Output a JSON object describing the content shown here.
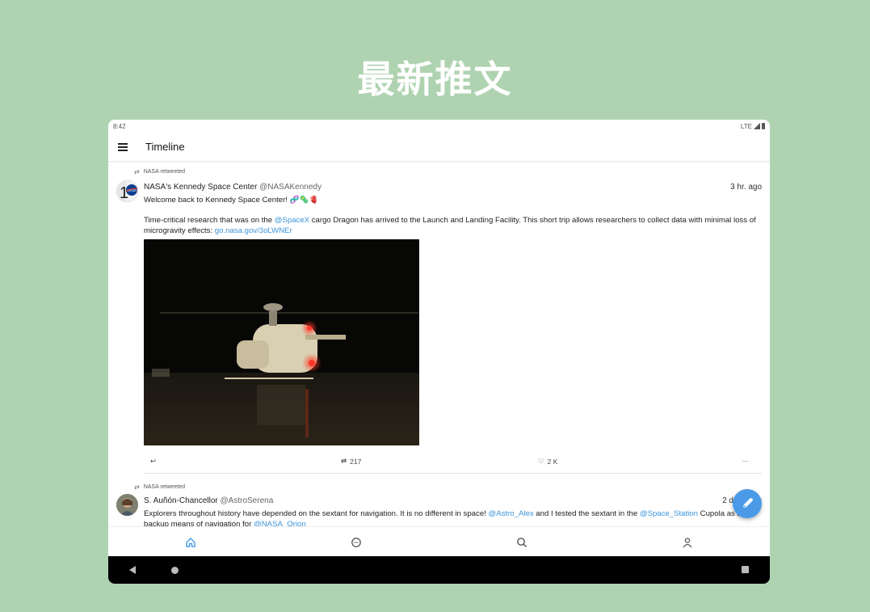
{
  "banner": {
    "title": "最新推文"
  },
  "status_bar": {
    "time": "8:42",
    "network": "LTE"
  },
  "app_bar": {
    "title": "Timeline"
  },
  "tweets": [
    {
      "retweeted_by": "NASA retweeted",
      "author": "NASA's Kennedy Space Center",
      "handle": "@NASAKennedy",
      "time": "3 hr. ago",
      "line1": "Welcome back to Kennedy Space Center! 🧬🦠🫀",
      "text_a": "Time-critical research that was on the ",
      "mention": "@SpaceX",
      "text_b": " cargo Dragon has arrived to the Launch and Landing Facility. This short trip allows researchers to collect data with minimal loss of microgravity effects: ",
      "link": "go.nasa.gov/3oLWNEr",
      "retweets": "217",
      "likes": "2 K"
    },
    {
      "retweeted_by": "NASA retweeted",
      "author": "S. Auñón-Chancellor",
      "handle": "@AstroSerena",
      "time": "2 days ago",
      "text_a": "Explorers throughout history have depended on the sextant for navigation. It is no different in space! ",
      "mention1": "@Astro_Alex",
      "text_b": " and I tested the sextant in the ",
      "mention2": "@Space_Station",
      "text_c": " Cupola as a backup means of navigation for ",
      "mention3": "@NASA_Orion"
    }
  ],
  "icons": {
    "reply": "reply-icon",
    "retweet": "retweet-icon",
    "like": "heart-icon",
    "more": "more-icon",
    "compose": "compose-icon",
    "nav_home": "home-icon",
    "nav_messages": "messages-icon",
    "nav_search": "search-icon",
    "nav_profile": "profile-icon"
  },
  "colors": {
    "background": "#afd3b1",
    "accent": "#4a9ae8",
    "link": "#3b94d9"
  }
}
